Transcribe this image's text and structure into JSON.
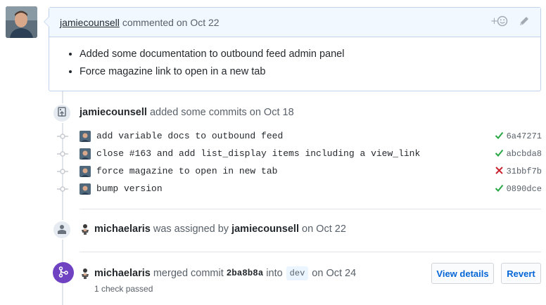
{
  "comment": {
    "author": "jamiecounsell",
    "action_text": "commented on Oct 22",
    "add_reaction_icon": "smiley-plus-icon",
    "edit_icon": "pencil-icon",
    "items": [
      "Added some documentation to outbound feed admin panel",
      "Force magazine link to open in a new tab"
    ]
  },
  "commits_event": {
    "author": "jamiecounsell",
    "text": "added some commits on Oct 18",
    "commits": [
      {
        "message": "add variable docs to outbound feed",
        "status": "success",
        "sha": "6a47271"
      },
      {
        "message": "close #163 and add list_display items including a view_link",
        "status": "success",
        "sha": "abcbda8"
      },
      {
        "message": "force magazine to open in new tab",
        "status": "failure",
        "sha": "31bbf7b"
      },
      {
        "message": "bump version",
        "status": "success",
        "sha": "0890dce"
      }
    ]
  },
  "assign_event": {
    "assignee": "michaelaris",
    "text_mid": "was assigned by",
    "assigner": "jamiecounsell",
    "text_end": "on Oct 22"
  },
  "merge_event": {
    "actor": "michaelaris",
    "text_mid": "merged commit",
    "sha": "2ba8b8a",
    "into": "into",
    "branch": "dev",
    "date_text": "on Oct 24",
    "checks": "1 check passed",
    "view_details_label": "View details",
    "revert_label": "Revert"
  },
  "colors": {
    "success": "#28a745",
    "failure": "#cb2431",
    "merge": "#6f42c1",
    "link": "#0366d6"
  }
}
